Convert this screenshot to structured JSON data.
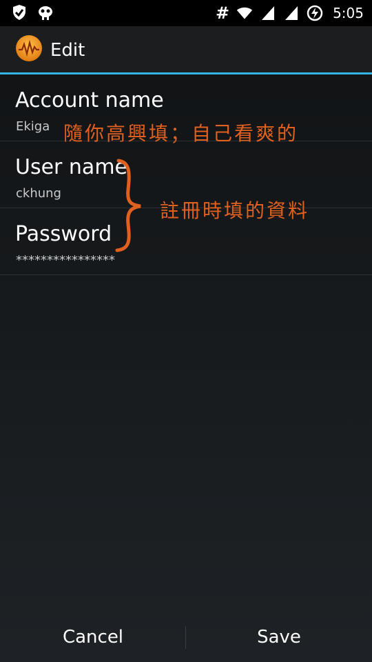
{
  "status_bar": {
    "time": "5:05",
    "hash_symbol": "#",
    "icons": [
      "shield-check-icon",
      "android-debug-icon",
      "wifi-icon",
      "signal-icon",
      "signal-icon",
      "battery-charging-icon"
    ]
  },
  "action_bar": {
    "title": "Edit",
    "icon": "ekiga-app-icon"
  },
  "fields": [
    {
      "label": "Account name",
      "value": "Ekiga"
    },
    {
      "label": "User name",
      "value": "ckhung"
    },
    {
      "label": "Password",
      "value": "****************"
    }
  ],
  "annotations": {
    "note1": "隨你高興填；自己看爽的",
    "note2": "註冊時填的資料"
  },
  "buttons": {
    "cancel": "Cancel",
    "save": "Save"
  },
  "colors": {
    "accent": "#33b5e5",
    "annotation": "#e06020"
  }
}
